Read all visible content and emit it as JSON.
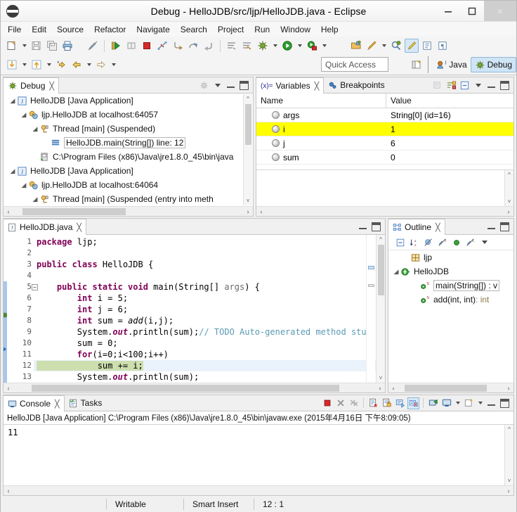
{
  "window": {
    "title": "Debug - HelloJDB/src/ljp/HelloJDB.java - Eclipse",
    "minimize": "–",
    "maximize": "❐",
    "close": "×"
  },
  "menubar": {
    "items": [
      "File",
      "Edit",
      "Source",
      "Refactor",
      "Navigate",
      "Search",
      "Project",
      "Run",
      "Window",
      "Help"
    ]
  },
  "toolbar": {
    "quick_access_placeholder": "Quick Access",
    "perspectives": [
      {
        "label": "Java",
        "active": false
      },
      {
        "label": "Debug",
        "active": true
      }
    ]
  },
  "debug_view": {
    "tab_label": "Debug",
    "close_glyph": "╳",
    "tree": [
      {
        "indent": 0,
        "twisty": "open",
        "icon": "java-application-icon",
        "label": "HelloJDB [Java Application]",
        "selected": false
      },
      {
        "indent": 1,
        "twisty": "open",
        "icon": "debug-target-icon",
        "label": "ljp.HelloJDB at localhost:64057",
        "selected": false
      },
      {
        "indent": 2,
        "twisty": "open",
        "icon": "thread-suspended-icon",
        "label": "Thread [main] (Suspended)",
        "selected": false
      },
      {
        "indent": 3,
        "twisty": "none",
        "icon": "stack-frame-icon",
        "label": "HelloJDB.main(String[]) line: 12",
        "selected": true
      },
      {
        "indent": 2,
        "twisty": "none",
        "icon": "process-icon",
        "label": "C:\\Program Files (x86)\\Java\\jre1.8.0_45\\bin\\java",
        "selected": false
      },
      {
        "indent": 0,
        "twisty": "open",
        "icon": "java-application-icon",
        "label": "HelloJDB [Java Application]",
        "selected": false
      },
      {
        "indent": 1,
        "twisty": "open",
        "icon": "debug-target-icon",
        "label": "ljp.HelloJDB at localhost:64064",
        "selected": false
      },
      {
        "indent": 2,
        "twisty": "open",
        "icon": "thread-suspended-icon",
        "label": "Thread [main] (Suspended (entry into meth",
        "selected": false
      }
    ]
  },
  "variables_view": {
    "tabs": [
      {
        "label": "Variables",
        "icon": "variables-icon",
        "selected": true
      },
      {
        "label": "Breakpoints",
        "icon": "breakpoints-icon",
        "selected": false
      }
    ],
    "close_glyph": "╳",
    "columns": [
      "Name",
      "Value"
    ],
    "rows": [
      {
        "name": "args",
        "value": "String[0]  (id=16)",
        "highlighted": false
      },
      {
        "name": "i",
        "value": "1",
        "highlighted": true
      },
      {
        "name": "j",
        "value": "6",
        "highlighted": false
      },
      {
        "name": "sum",
        "value": "0",
        "highlighted": false
      }
    ],
    "highlight_color": "#ffff00"
  },
  "editor": {
    "tab_label": "HelloJDB.java",
    "close_glyph": "╳",
    "current_line": 12,
    "lines": [
      {
        "n": 1,
        "text": "package ljp;"
      },
      {
        "n": 2,
        "text": ""
      },
      {
        "n": 3,
        "text": "public class HelloJDB {"
      },
      {
        "n": 4,
        "text": ""
      },
      {
        "n": 5,
        "text": "    public static void main(String[] args) {"
      },
      {
        "n": 6,
        "text": "        int i = 5;"
      },
      {
        "n": 7,
        "text": "        int j = 6;"
      },
      {
        "n": 8,
        "text": "        int sum = add(i,j);"
      },
      {
        "n": 9,
        "text": "        System.out.println(sum);// TODO Auto-generated method stub"
      },
      {
        "n": 10,
        "text": "        sum = 0;"
      },
      {
        "n": 11,
        "text": "        for(i=0;i<100;i++)"
      },
      {
        "n": 12,
        "text": "            sum += i;"
      },
      {
        "n": 13,
        "text": "        System.out.println(sum);"
      }
    ]
  },
  "outline_view": {
    "tab_label": "Outline",
    "close_glyph": "╳",
    "tree": [
      {
        "indent": 1,
        "twisty": "none",
        "icon": "package-icon",
        "label": "ljp",
        "selected": false,
        "suffix": ""
      },
      {
        "indent": 0,
        "twisty": "open",
        "icon": "class-icon",
        "label": "HelloJDB",
        "selected": false,
        "suffix": ""
      },
      {
        "indent": 2,
        "twisty": "none",
        "icon": "method-public-static-icon",
        "label": "main(String[]) : v",
        "selected": true,
        "suffix": ""
      },
      {
        "indent": 2,
        "twisty": "none",
        "icon": "method-public-static-icon",
        "label": "add(int, int) ",
        "selected": false,
        "suffix": ": int"
      }
    ]
  },
  "console_view": {
    "tabs": [
      {
        "label": "Console",
        "icon": "console-icon",
        "selected": true
      },
      {
        "label": "Tasks",
        "icon": "tasks-icon",
        "selected": false
      }
    ],
    "close_glyph": "╳",
    "header": "HelloJDB [Java Application] C:\\Program Files (x86)\\Java\\jre1.8.0_45\\bin\\javaw.exe (2015年4月16日 下午8:09:05)",
    "output": "11"
  },
  "statusbar": {
    "writable": "Writable",
    "insert_mode": "Smart Insert",
    "position": "12 : 1"
  }
}
